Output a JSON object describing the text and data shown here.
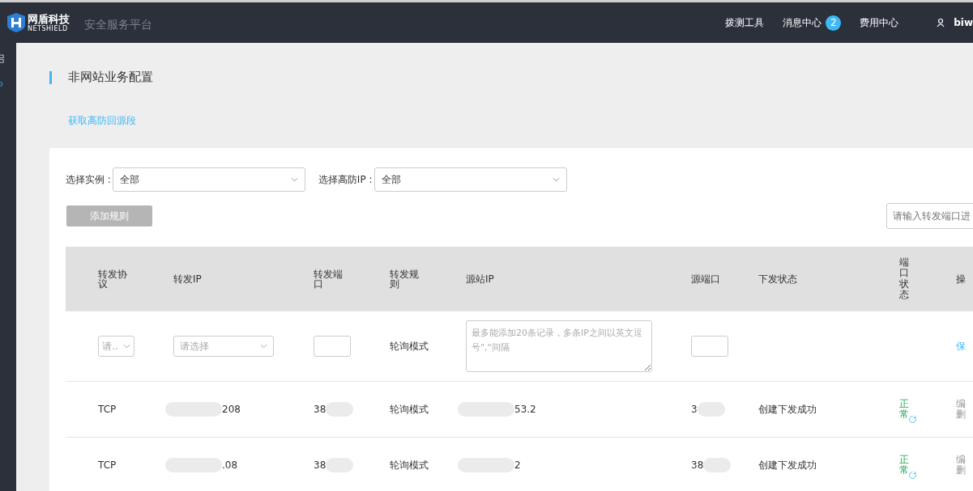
{
  "topbar": {
    "logo_text": "网盾科技",
    "logo_sub": "NETSHIELD",
    "platform_title": "安全服务平台",
    "nav": [
      {
        "label": "拨测工具"
      },
      {
        "label": "消息中心",
        "badge": "2"
      },
      {
        "label": "费用中心"
      }
    ],
    "user": "biw"
  },
  "page_title": "非网站业务配置",
  "link": "获取高防回源段",
  "filters": [
    {
      "label": "选择实例 :",
      "value": "全部"
    },
    {
      "label": "选择高防IP :",
      "value": "全部"
    }
  ],
  "add_button": {
    "label": "添加规则",
    "disabled": true
  },
  "search": {
    "placeholder": "请输入转发端口进"
  },
  "table": {
    "columns": [
      {
        "label": "转发协议"
      },
      {
        "label": "转发IP"
      },
      {
        "label": "转发端口"
      },
      {
        "label": "转发规则"
      },
      {
        "label": "源站IP"
      },
      {
        "label": "源端口"
      },
      {
        "label": "下发状态"
      },
      {
        "label": "端口状态",
        "vertical": true
      },
      {
        "label": "操"
      }
    ],
    "new_row": {
      "protocol_placeholder": "请..",
      "ip_placeholder": "请选择",
      "rule": "轮询模式",
      "source_placeholder": "最多能添加20条记录，多条IP之间以英文逗号\",\"间隔",
      "action": "保"
    },
    "rows": [
      {
        "protocol": "TCP",
        "ip": "208",
        "port": "38",
        "rule": "轮询模式",
        "source_ip": "53.2",
        "source_port": "3",
        "dispatch": "创建下发成功",
        "port_status": "正常",
        "actions": [
          "编",
          "删"
        ]
      },
      {
        "protocol": "TCP",
        "ip": ".08",
        "port": "38",
        "rule": "轮询模式",
        "source_ip": "2",
        "source_port": "38",
        "dispatch": "创建下发成功",
        "port_status": "正常",
        "actions": [
          "编",
          "删"
        ]
      }
    ]
  }
}
